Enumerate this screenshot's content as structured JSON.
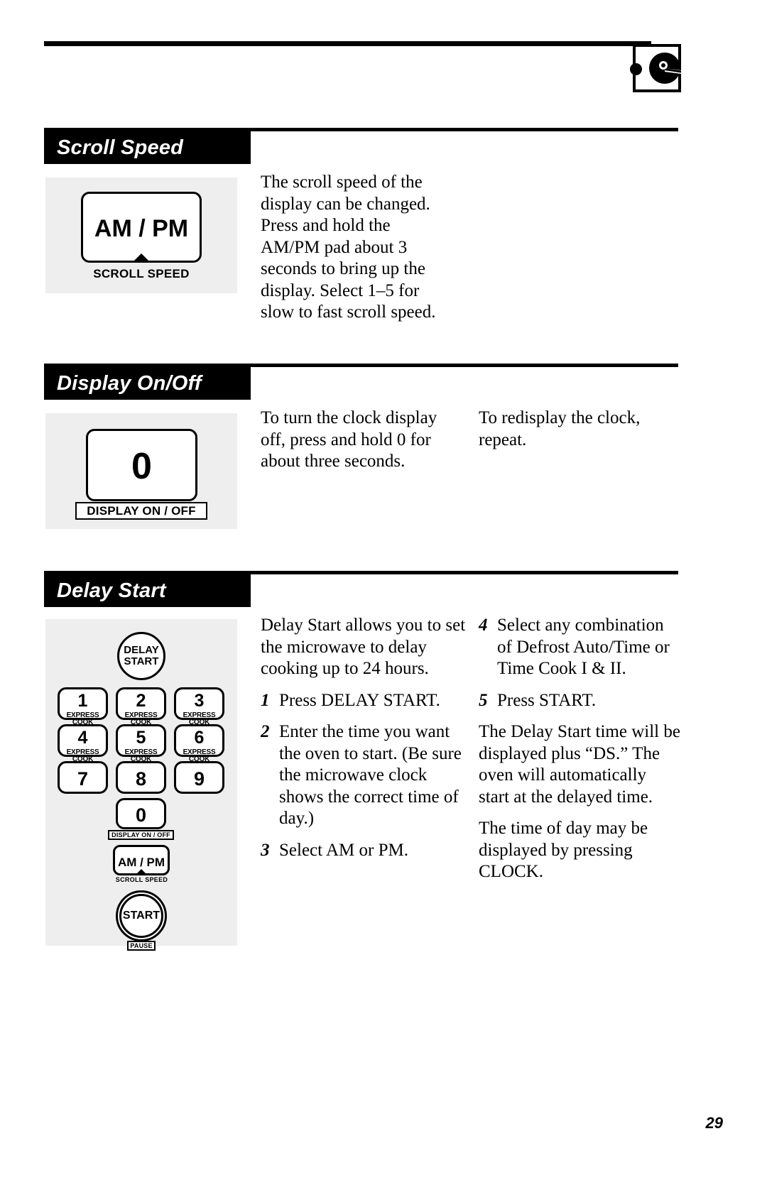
{
  "page": {
    "number": "29",
    "corner_icon": "knob-dial-icon"
  },
  "sections": [
    {
      "id": "scroll-speed",
      "title": "Scroll Speed",
      "illustration": {
        "pad_label": "AM / PM",
        "caption": "SCROLL SPEED",
        "marker": "up-triangle-icon"
      },
      "columns": [
        {
          "paragraphs": [
            "The scroll speed of the display can be changed. Press and hold the AM/PM pad about 3 seconds to bring up the display. Select 1–5 for slow to fast scroll speed."
          ]
        }
      ]
    },
    {
      "id": "display-on-off",
      "title": "Display On/Off",
      "illustration": {
        "pad_label": "0",
        "caption": "DISPLAY ON / OFF"
      },
      "columns": [
        {
          "paragraphs": [
            "To turn the clock display off, press and hold 0 for about three seconds."
          ]
        },
        {
          "paragraphs": [
            "To redisplay the clock, repeat."
          ]
        }
      ]
    },
    {
      "id": "delay-start",
      "title": "Delay Start",
      "illustration": {
        "delay_start_button": "DELAY START",
        "delay_start_line1": "DELAY",
        "delay_start_line2": "START",
        "keys": [
          {
            "digit": "1",
            "sub": "EXPRESS COOK"
          },
          {
            "digit": "2",
            "sub": "EXPRESS COOK"
          },
          {
            "digit": "3",
            "sub": "EXPRESS COOK"
          },
          {
            "digit": "4",
            "sub": "EXPRESS COOK"
          },
          {
            "digit": "5",
            "sub": "EXPRESS COOK"
          },
          {
            "digit": "6",
            "sub": "EXPRESS COOK"
          },
          {
            "digit": "7",
            "sub": ""
          },
          {
            "digit": "8",
            "sub": ""
          },
          {
            "digit": "9",
            "sub": ""
          }
        ],
        "zero_key": "0",
        "zero_caption": "DISPLAY ON / OFF",
        "ampm_key": "AM / PM",
        "ampm_caption": "SCROLL SPEED",
        "start_button": "START",
        "pause_caption": "PAUSE"
      },
      "columns": [
        {
          "intro": "Delay Start allows you to set the microwave to delay cooking up to 24 hours.",
          "steps": [
            {
              "num": "1",
              "text": "Press DELAY START."
            },
            {
              "num": "2",
              "text": "Enter the time you want the oven to start. (Be sure the microwave clock shows the correct time of day.)"
            },
            {
              "num": "3",
              "text": "Select AM or PM."
            }
          ]
        },
        {
          "steps": [
            {
              "num": "4",
              "text": "Select any combination of Defrost Auto/Time or Time Cook I & II."
            },
            {
              "num": "5",
              "text": "Press START."
            }
          ],
          "paragraphs": [
            "The Delay Start time will be displayed plus “DS.” The oven will automatically start at the delayed time.",
            "The time of day may be displayed by pressing CLOCK."
          ]
        }
      ]
    }
  ]
}
